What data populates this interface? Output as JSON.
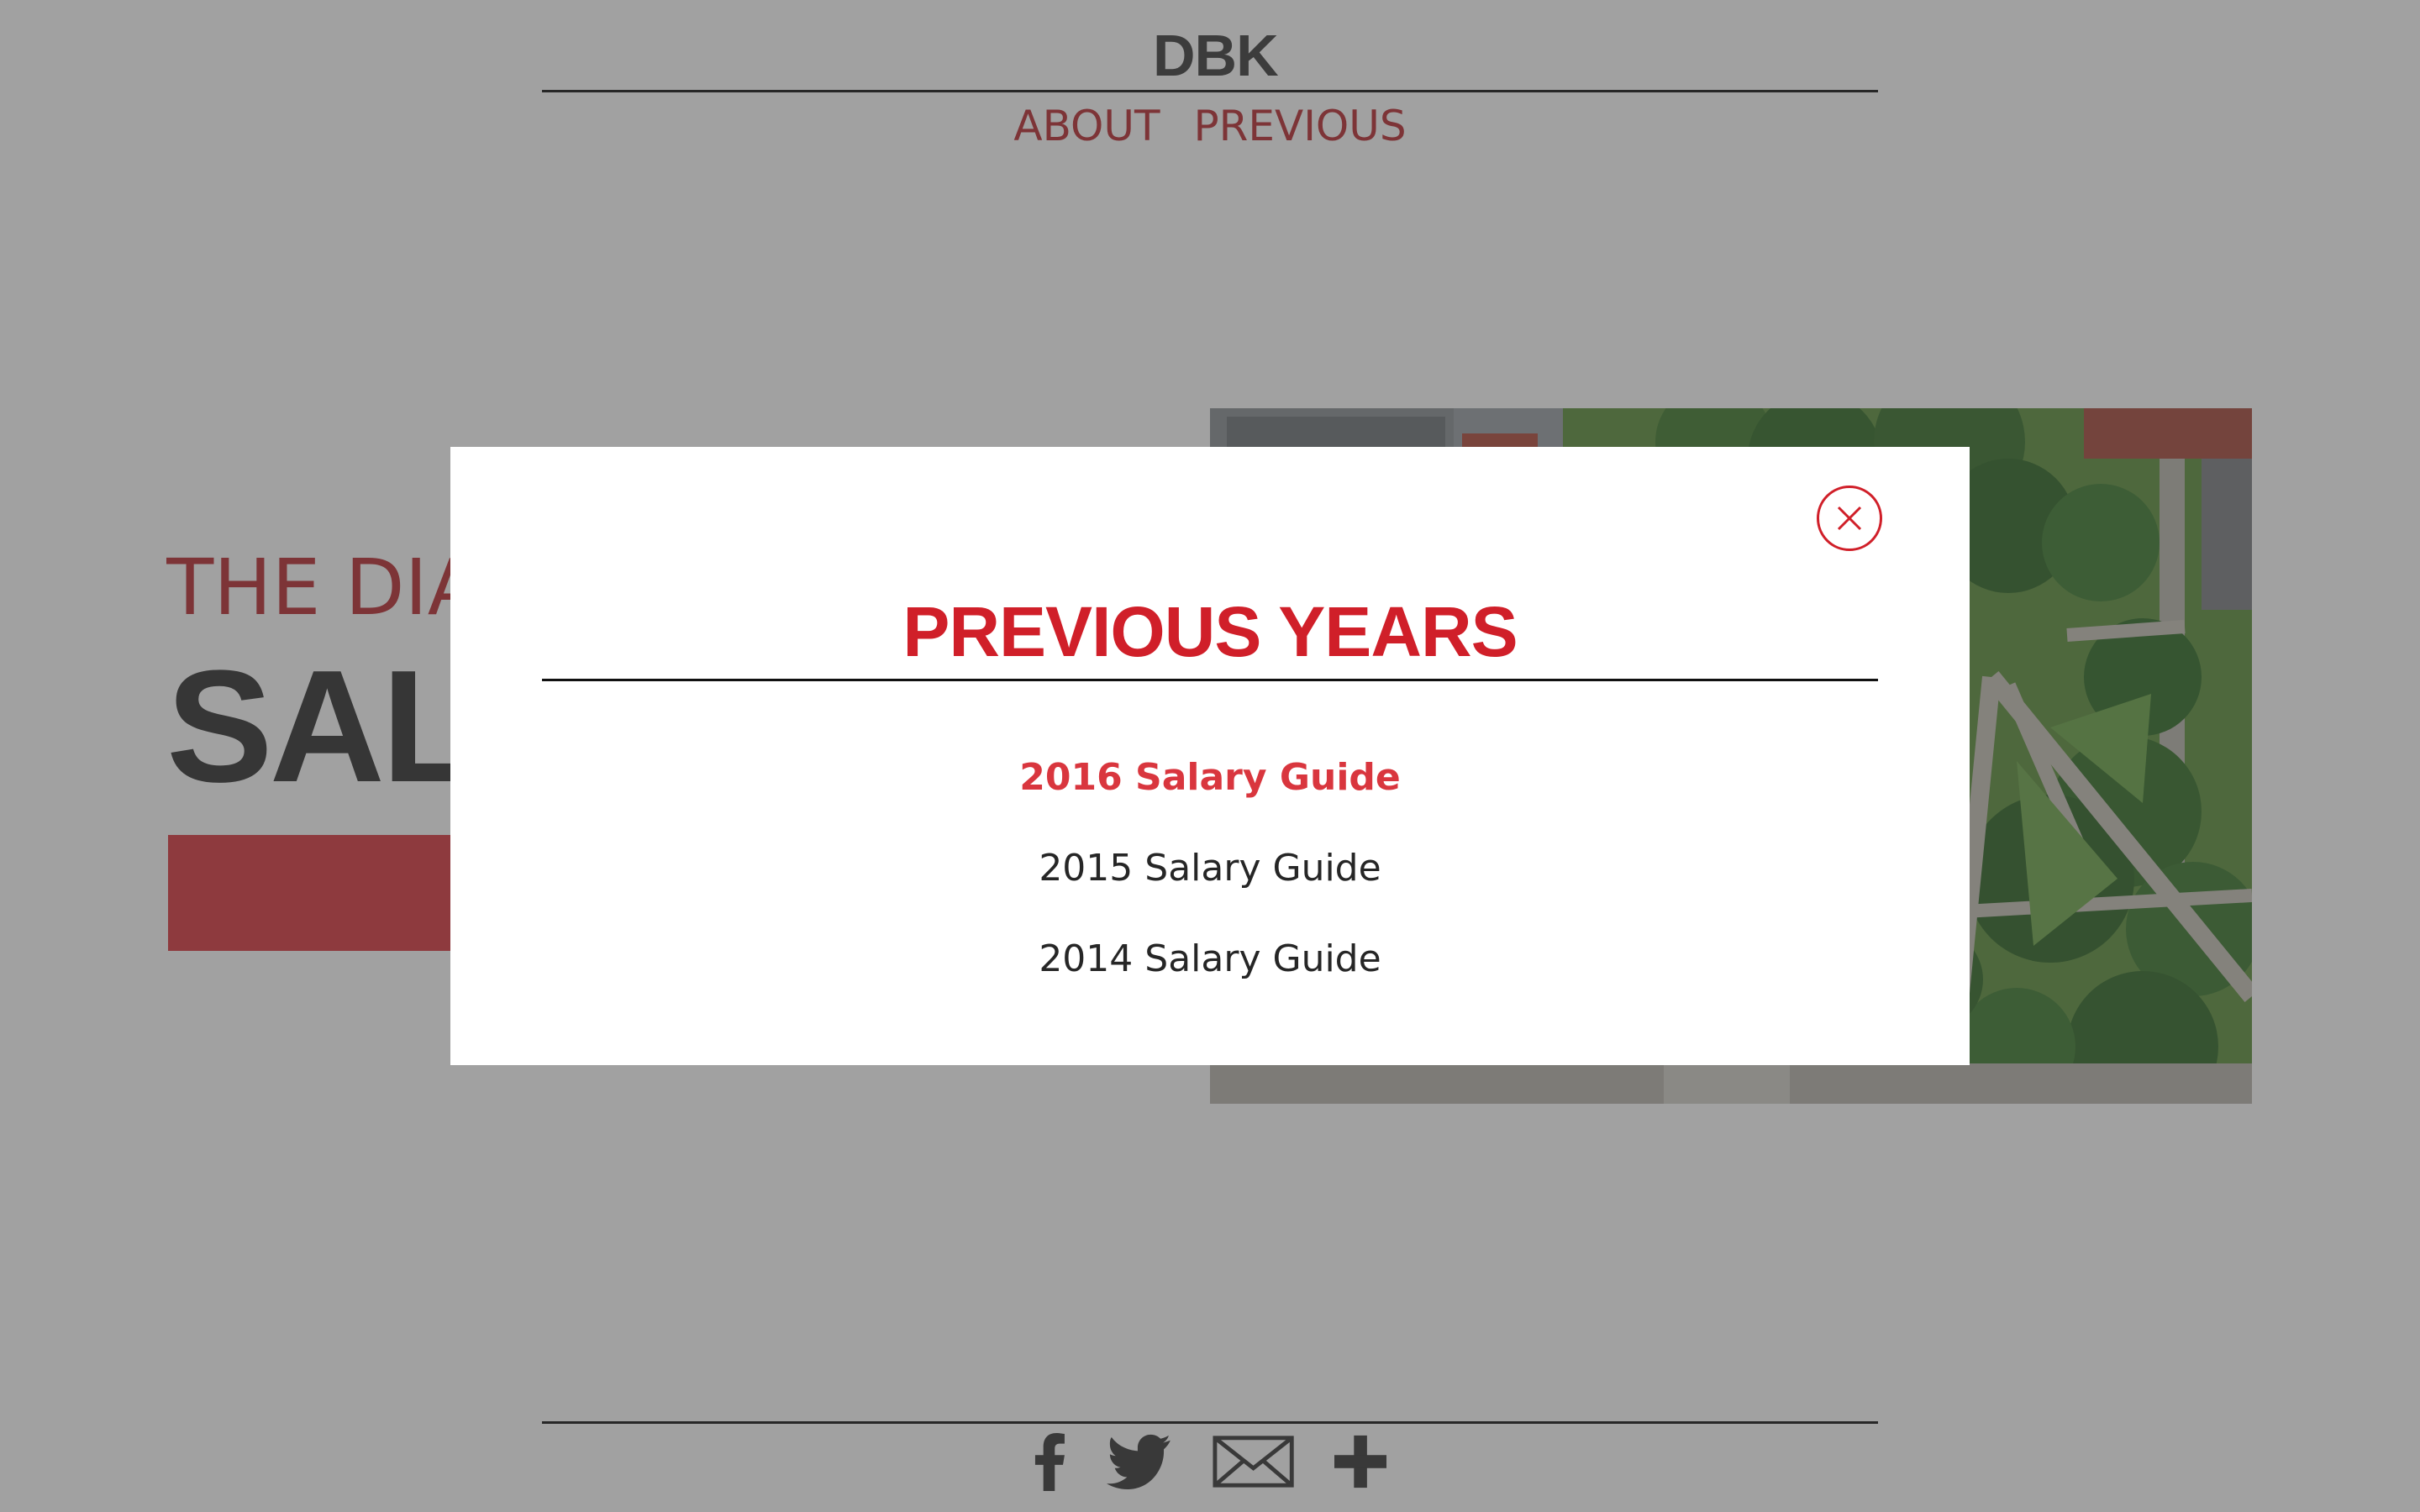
{
  "header": {
    "logo": "DBK",
    "nav": [
      {
        "label": "ABOUT"
      },
      {
        "label": "PREVIOUS"
      }
    ]
  },
  "hero": {
    "kicker": "THE DIA",
    "title": "SAL"
  },
  "footer": {
    "social_icons": [
      "facebook-icon",
      "twitter-icon",
      "mail-icon",
      "plus-icon"
    ]
  },
  "modal": {
    "title": "PREVIOUS YEARS",
    "items": [
      {
        "label": "2016 Salary Guide",
        "active": true
      },
      {
        "label": "2015 Salary Guide",
        "active": false
      },
      {
        "label": "2014 Salary Guide",
        "active": false
      }
    ]
  },
  "colors": {
    "accent_red": "#d01f29",
    "nav_red": "#b82a2f",
    "overlay": "rgba(63,63,63,0.49)"
  }
}
